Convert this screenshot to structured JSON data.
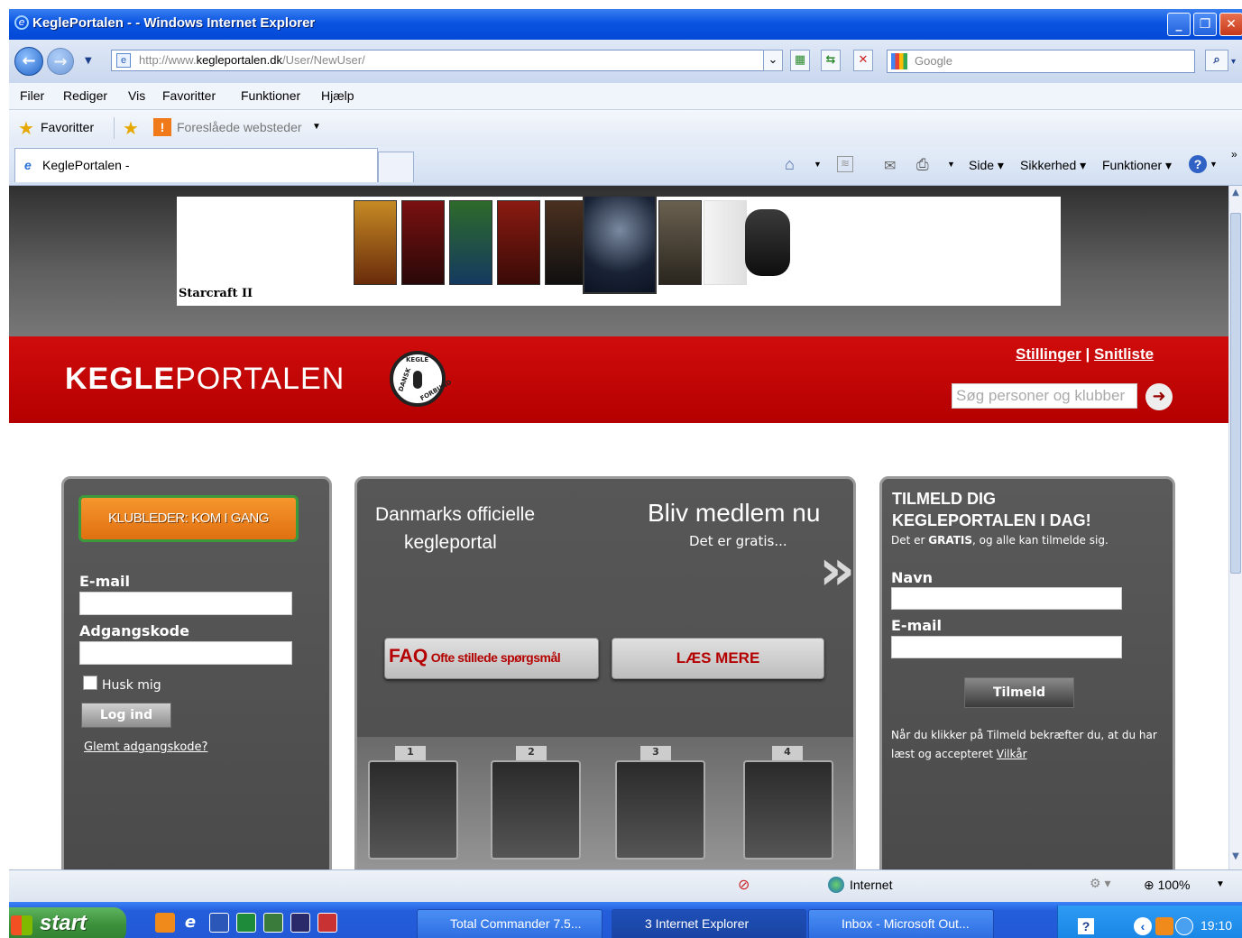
{
  "window": {
    "title": "KeglePortalen - - Windows Internet Explorer"
  },
  "address": {
    "prefix": "http://www.",
    "domain": "kegleportalen.dk",
    "path": "/User/NewUser/"
  },
  "search_engine": {
    "placeholder": "Google"
  },
  "menu": [
    "Filer",
    "Rediger",
    "Vis",
    "Favoritter",
    "Funktioner",
    "Hjælp"
  ],
  "favorites_bar": {
    "favorites": "Favoritter",
    "suggested": "Foreslåede websteder"
  },
  "tab": {
    "title": "KeglePortalen -"
  },
  "command_bar": {
    "side": "Side",
    "sikkerhed": "Sikkerhed",
    "funktioner": "Funktioner"
  },
  "page": {
    "banner": {
      "caption": "Starcraft II"
    },
    "header": {
      "logo_bold": "KEGLE",
      "logo_light": "PORTALEN",
      "seal_top": "KEGLE",
      "seal_left": "DANSK",
      "seal_right": "FORBUND",
      "link_stillinger": "Stillinger",
      "separator": "|",
      "link_snitliste": "Snitliste",
      "search_placeholder": "Søg personer og klubber"
    },
    "login": {
      "klubleder_button": "KLUBLEDER: KOM I GANG",
      "email_label": "E-mail",
      "password_label": "Adgangskode",
      "remember_label": "Husk mig",
      "login_button": "Log ind",
      "forgot_link": "Glemt adgangskode?"
    },
    "center": {
      "tagline_1": "Danmarks officielle",
      "tagline_2": "kegleportal",
      "join_title": "Bliv medlem nu",
      "join_sub": "Det er gratis...",
      "faq_big": "FAQ",
      "faq_small": "Ofte stillede spørgsmål",
      "read_more": "LÆS MERE",
      "lane_numbers": [
        "1",
        "2",
        "3",
        "4"
      ]
    },
    "signup": {
      "title_1": "TILMELD DIG",
      "title_2": "KEGLEPORTALEN I DAG!",
      "sub_pre": "Det er ",
      "sub_bold": "GRATIS",
      "sub_post": ", og alle kan tilmelde sig.",
      "name_label": "Navn",
      "email_label": "E-mail",
      "submit": "Tilmeld",
      "terms_pre": "Når du klikker på Tilmeld bekræfter du, at du har læst og accepteret ",
      "terms_link": "Vilkår"
    }
  },
  "status": {
    "zone": "Internet",
    "zoom": "100%"
  },
  "taskbar": {
    "start": "start",
    "tasks": [
      "Total Commander 7.5...",
      "3 Internet Explorer",
      "Inbox - Microsoft Out..."
    ],
    "clock": "19:10"
  },
  "colors": {
    "brand_red": "#c00000",
    "orange": "#f0841f",
    "panel_grey": "#555555"
  }
}
